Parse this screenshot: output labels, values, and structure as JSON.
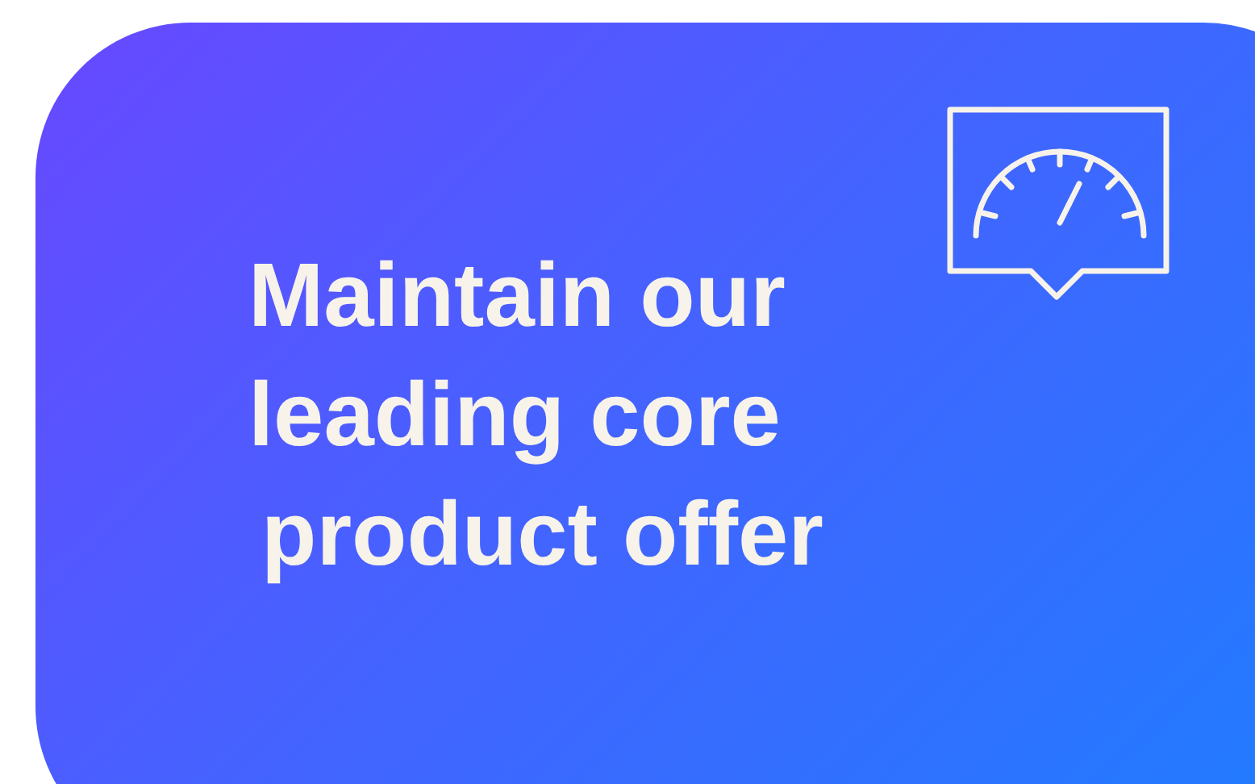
{
  "card": {
    "heading_lines": [
      "Maintain our",
      "leading core",
      "product offer"
    ]
  }
}
